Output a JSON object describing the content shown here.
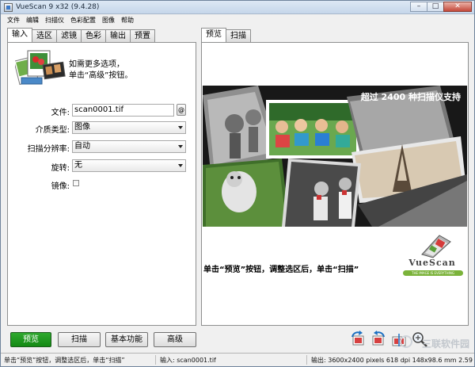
{
  "window": {
    "title": "VueScan 9 x32 (9.4.28)"
  },
  "menu": [
    "文件",
    "编辑",
    "扫描仪",
    "色彩配置",
    "图像",
    "帮助"
  ],
  "left_tabs": [
    "输入",
    "选区",
    "滤镜",
    "色彩",
    "输出",
    "预置"
  ],
  "right_tabs": [
    "预览",
    "扫描"
  ],
  "info": {
    "line1": "如需更多选项，",
    "line2": "单击“高级”按钮。"
  },
  "form": {
    "file_label": "文件:",
    "file_value": "scan0001.tif",
    "at_label": "@",
    "media_label": "介质类型:",
    "media_value": "图像",
    "resolution_label": "扫描分辨率:",
    "resolution_value": "自动",
    "rotate_label": "旋转:",
    "rotate_value": "无",
    "mirror_label": "镜像:"
  },
  "buttons": {
    "preview": "预览",
    "scan": "扫描",
    "basic": "基本功能",
    "advanced": "高级"
  },
  "preview": {
    "banner_title": "超过 2400 种扫描仪支持",
    "instruction": "单击“预览”按钮，调整选区后，单击“扫描”",
    "logo_text": "VueScan",
    "logo_tagline": "THE IMAGE IS EVERYTHING"
  },
  "status": {
    "left": "单击“预览”按钮，调整选区后，单击“扫描”",
    "middle": "输入: scan0001.tif",
    "right": "输出: 3600x2400 pixels 618 dpi 148x98.6 mm 2.59"
  },
  "watermark": "三联软件园",
  "colors": {
    "green_button": "#1a961a",
    "logo_green": "#7bb33a",
    "banner_bg": "#1a1a1a"
  }
}
